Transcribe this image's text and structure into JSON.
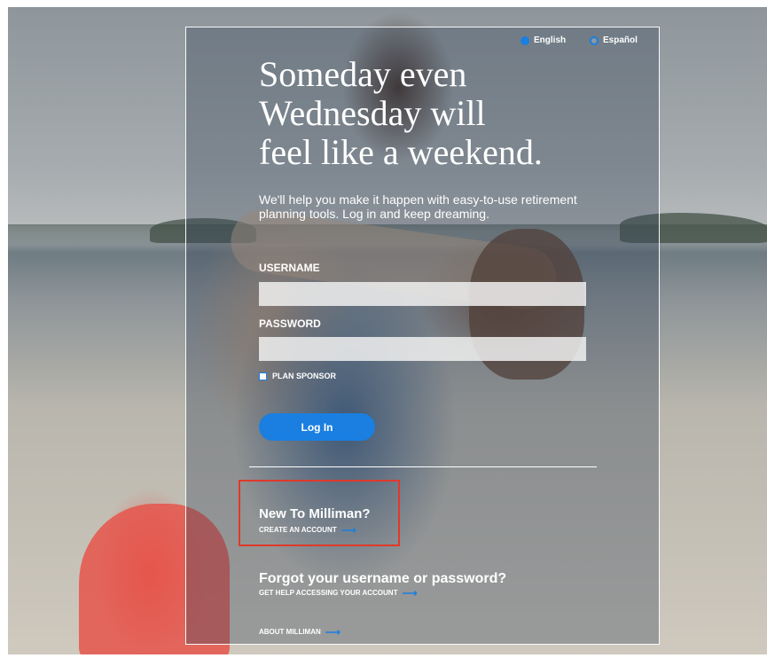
{
  "language": {
    "english_label": "English",
    "spanish_label": "Español",
    "selected": "English"
  },
  "hero": {
    "headline_line1": "Someday even",
    "headline_line2": "Wednesday will",
    "headline_line3": "feel like a weekend.",
    "subhead": "We'll help you make it happen with easy-to-use retirement planning tools. Log in and keep dreaming."
  },
  "form": {
    "username_label": "USERNAME",
    "username_value": "",
    "password_label": "PASSWORD",
    "password_value": "",
    "plan_sponsor_label": "PLAN SPONSOR",
    "login_label": "Log In"
  },
  "new_user": {
    "title": "New To Milliman?",
    "link": "CREATE AN ACCOUNT"
  },
  "forgot": {
    "title": "Forgot your username or password?",
    "link": "GET HELP ACCESSING YOUR ACCOUNT"
  },
  "about": {
    "link": "ABOUT MILLIMAN"
  },
  "icons": {
    "arrow": "arrow-right-icon",
    "radio": "radio-icon",
    "checkbox": "checkbox-icon"
  },
  "colors": {
    "accent": "#1a7fe0",
    "highlight": "#e0392b"
  }
}
